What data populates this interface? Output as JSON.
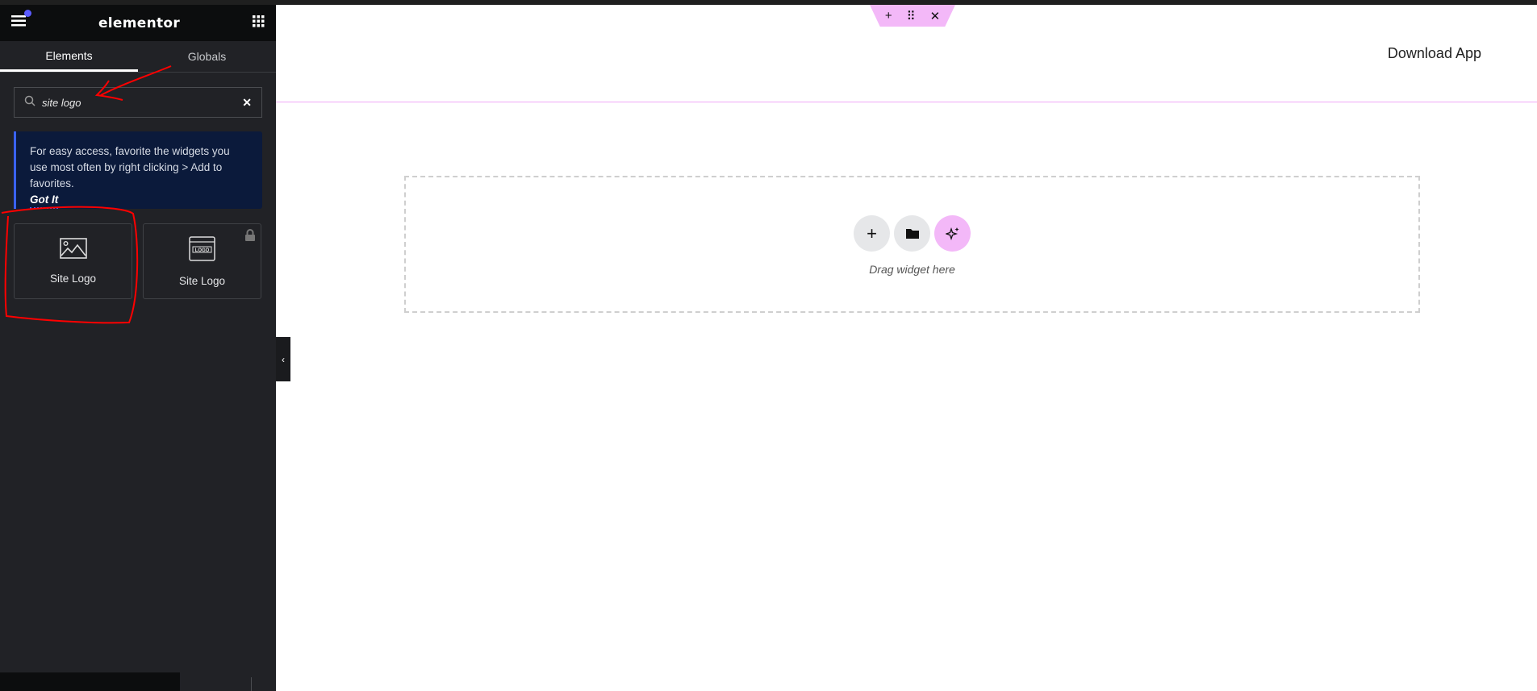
{
  "sidebar": {
    "logo": "elementor",
    "tabs": [
      {
        "label": "Elements",
        "active": true
      },
      {
        "label": "Globals",
        "active": false
      }
    ],
    "search": {
      "value": "site logo",
      "placeholder": "Search Widget..."
    },
    "notice": {
      "text": "For easy access, favorite the widgets you use most often by right clicking > Add to favorites.",
      "link": "Got It"
    },
    "widgets": [
      {
        "label": "Site Logo",
        "icon": "image-icon",
        "locked": false
      },
      {
        "label": "Site Logo",
        "icon": "logo-icon",
        "locked": true
      }
    ]
  },
  "canvas": {
    "header_link": "Download App",
    "drop_text": "Drag widget here"
  },
  "colors": {
    "accent": "#f3b8f8",
    "notice_bg": "#0b1a3b",
    "panel": "#212226",
    "annotation": "#ff0000"
  }
}
